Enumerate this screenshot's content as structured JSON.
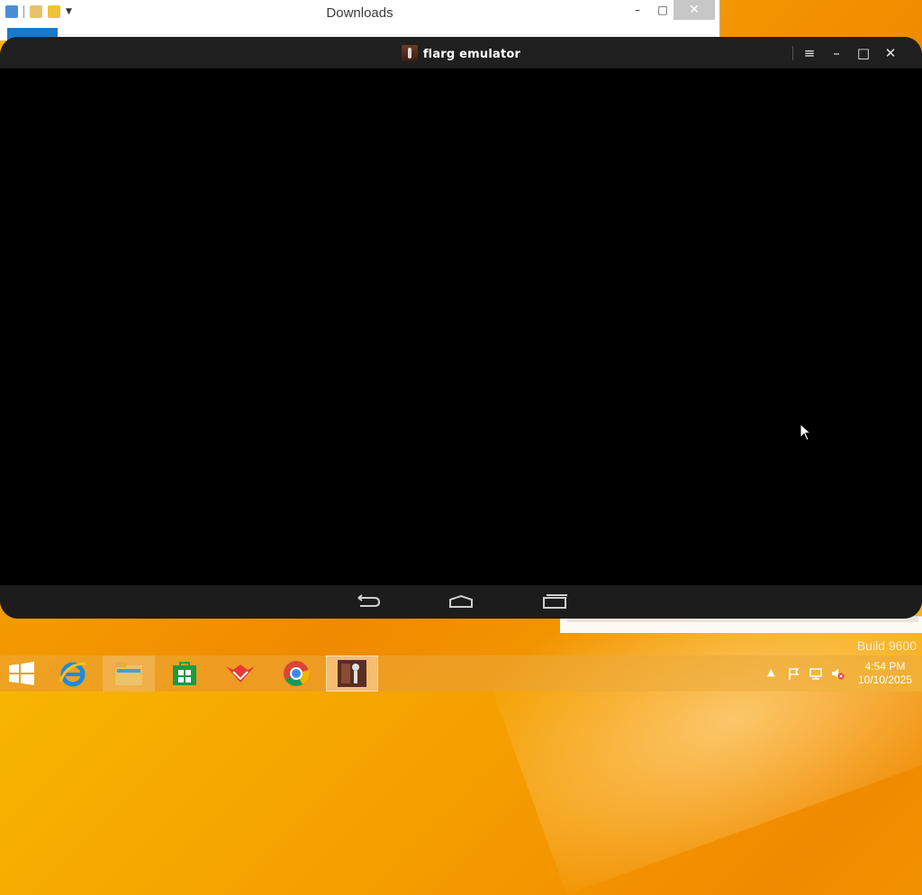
{
  "explorer": {
    "title": "Downloads",
    "minimize_label": "–",
    "maximize_label": "□",
    "close_label": "✕"
  },
  "emulator": {
    "title": "flarg emulator",
    "menu_icon": "≡",
    "minimize_icon": "–",
    "maximize_icon": "□",
    "close_icon": "✕"
  },
  "desktop": {
    "watermark": "Build 9600"
  },
  "taskbar": {
    "apps": [
      {
        "name": "internet-explorer",
        "pinned": true
      },
      {
        "name": "file-explorer",
        "pinned": true,
        "running": true
      },
      {
        "name": "store",
        "pinned": true
      },
      {
        "name": "red-fox-app",
        "pinned": true
      },
      {
        "name": "chrome",
        "pinned": true
      },
      {
        "name": "flarg-emulator",
        "running": true,
        "active": true
      }
    ],
    "clock": {
      "time": "4:54 PM",
      "date": "10/10/2025"
    }
  },
  "colors": {
    "desktop": "#f4a000",
    "emulator_titlebar": "#1f1f1f",
    "emulator_screen": "#000000",
    "explorer_ribbon": "#1979ca"
  }
}
